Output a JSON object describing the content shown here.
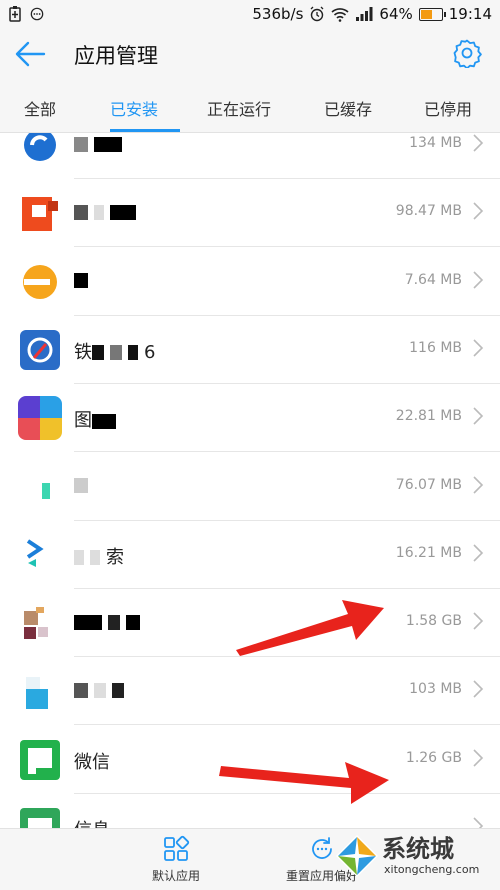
{
  "status": {
    "speed": "536b/s",
    "battery": "64%",
    "battery_level": 0.64,
    "time": "19:14"
  },
  "header": {
    "title": "应用管理"
  },
  "tabs": [
    "全部",
    "已安装",
    "正在运行",
    "已缓存",
    "已停用"
  ],
  "apps": [
    {
      "name": "",
      "size": "134 MB"
    },
    {
      "name": "",
      "size": "98.47 MB"
    },
    {
      "name": "",
      "size": "7.64 MB"
    },
    {
      "name": "铁",
      "suffix": "6",
      "size": "116 MB"
    },
    {
      "name": "图",
      "size": "22.81 MB"
    },
    {
      "name": "",
      "size": "76.07 MB"
    },
    {
      "name": "",
      "suffix": "索",
      "size": "16.21 MB"
    },
    {
      "name": "",
      "size": "1.58 GB"
    },
    {
      "name": "",
      "size": "103 MB"
    },
    {
      "name": "微信",
      "size": "1.26 GB"
    },
    {
      "name": "信息",
      "size": ""
    }
  ],
  "bottom": {
    "default_apps": "默认应用",
    "reset_prefs": "重置应用偏好"
  },
  "watermark": {
    "text": "系统城",
    "url": "xitongcheng.com"
  },
  "colors": {
    "accent": "#2196f3",
    "annotation_arrow": "#e8231c"
  }
}
